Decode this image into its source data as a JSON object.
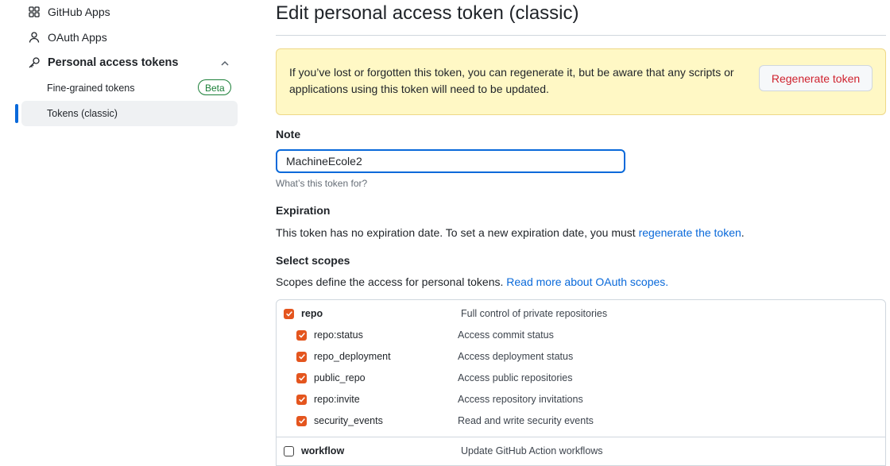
{
  "sidebar": {
    "items": [
      {
        "label": "GitHub Apps",
        "icon": "apps-icon"
      },
      {
        "label": "OAuth Apps",
        "icon": "person-icon"
      },
      {
        "label": "Personal access tokens",
        "icon": "key-icon"
      }
    ],
    "sub_items": [
      {
        "label": "Fine-grained tokens",
        "badge": "Beta"
      },
      {
        "label": "Tokens (classic)",
        "active": true
      }
    ]
  },
  "main": {
    "title": "Edit personal access token (classic)",
    "flash": {
      "text": "If you’ve lost or forgotten this token, you can regenerate it, but be aware that any scripts or applications using this token will need to be updated.",
      "button": "Regenerate token"
    },
    "note": {
      "label": "Note",
      "value": "MachineEcole2",
      "hint": "What’s this token for?"
    },
    "expiration": {
      "label": "Expiration",
      "text": "This token has no expiration date. To set a new expiration date, you must ",
      "link": "regenerate the token",
      "suffix": "."
    },
    "scopes": {
      "label": "Select scopes",
      "text": "Scopes define the access for personal tokens. ",
      "link": "Read more about OAuth scopes.",
      "rows": [
        {
          "name": "repo",
          "desc": "Full control of private repositories",
          "checked": true,
          "parent": true
        },
        {
          "name": "repo:status",
          "desc": "Access commit status",
          "checked": true
        },
        {
          "name": "repo_deployment",
          "desc": "Access deployment status",
          "checked": true
        },
        {
          "name": "public_repo",
          "desc": "Access public repositories",
          "checked": true
        },
        {
          "name": "repo:invite",
          "desc": "Access repository invitations",
          "checked": true
        },
        {
          "name": "security_events",
          "desc": "Read and write security events",
          "checked": true
        },
        {
          "name": "workflow",
          "desc": "Update GitHub Action workflows",
          "checked": false,
          "parent": true
        }
      ]
    }
  },
  "colors": {
    "accent": "#0969da",
    "checkbox": "#e4551e",
    "danger": "#cf222e",
    "flash_bg": "#fff8c5",
    "success": "#1a7f37"
  }
}
